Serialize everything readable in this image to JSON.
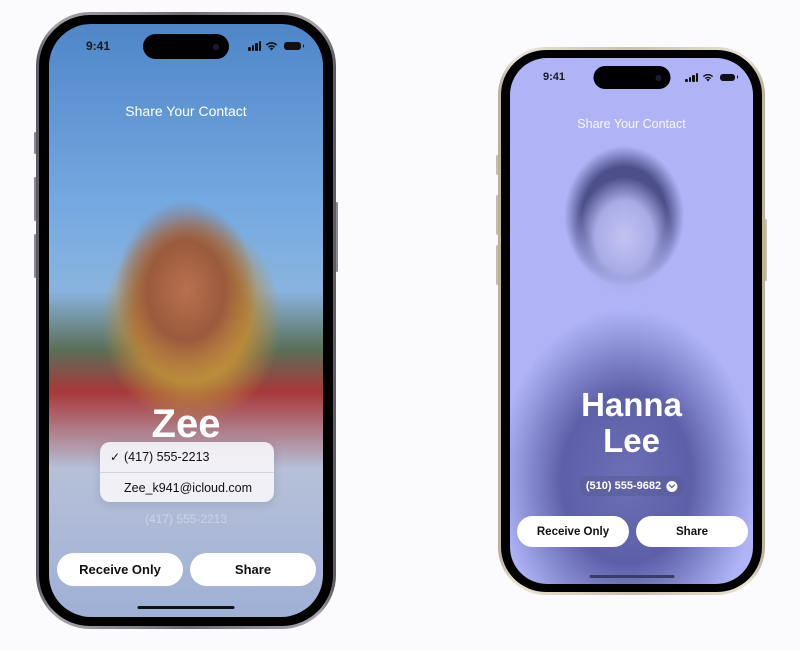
{
  "phones": [
    {
      "status": {
        "time": "9:41"
      },
      "title": "Share Your Contact",
      "contact": {
        "name": "Zee",
        "selected_phone": "(417) 555-2213"
      },
      "dropdown": {
        "options": [
          {
            "label": "(417) 555-2213",
            "selected": true,
            "check_glyph": "✓"
          },
          {
            "label": "Zee_k941@icloud.com",
            "selected": false,
            "check_glyph": ""
          }
        ]
      },
      "buttons": {
        "receive_only": "Receive Only",
        "share": "Share"
      },
      "theme": {
        "frame": "dark-titanium",
        "background": "photo"
      }
    },
    {
      "status": {
        "time": "9:41"
      },
      "title": "Share Your Contact",
      "contact": {
        "name_line1": "Hanna",
        "name_line2": "Lee",
        "phone": "(510) 555-9682"
      },
      "buttons": {
        "receive_only": "Receive Only",
        "share": "Share"
      },
      "theme": {
        "frame": "gold",
        "background": "#b0b4f7"
      }
    }
  ],
  "icons": {
    "signal": "cellular-signal-icon",
    "wifi": "wifi-icon",
    "battery": "battery-icon",
    "checkmark": "checkmark-icon",
    "chevron": "chevron-down-icon"
  }
}
